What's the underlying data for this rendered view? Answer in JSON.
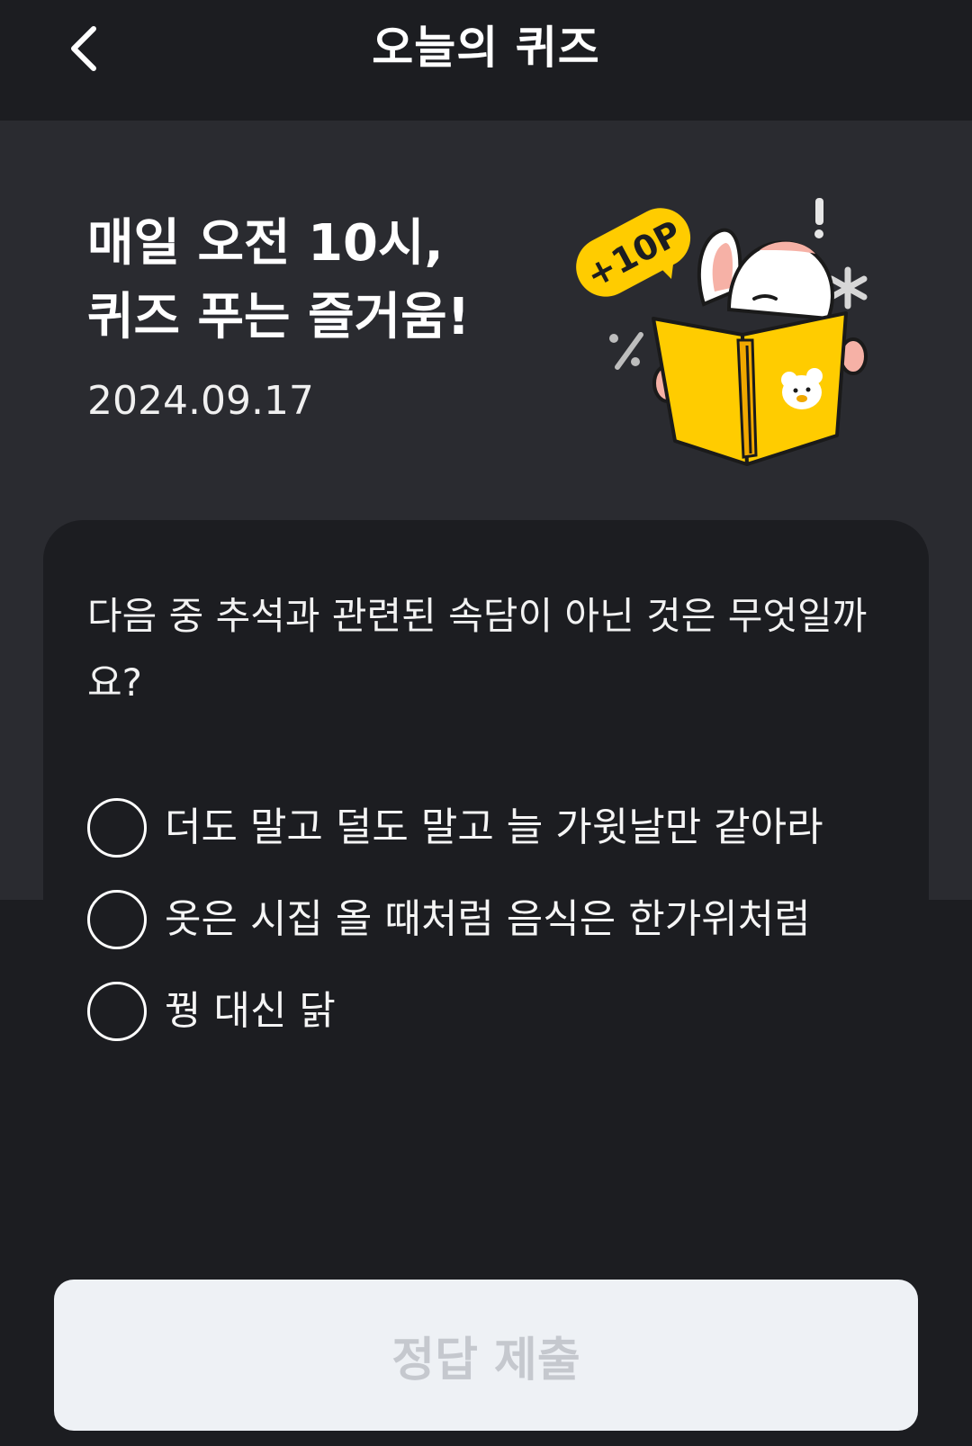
{
  "header": {
    "title": "오늘의 퀴즈",
    "back_icon": "chevron-left-icon"
  },
  "hero": {
    "title_line1": "매일 오전 10시,",
    "title_line2": "퀴즈 푸는 즐거움!",
    "date": "2024.09.17",
    "badge_text": "+10P",
    "illustration": "rabbit-reading-book"
  },
  "quiz": {
    "question": "다음 중 추석과 관련된 속담이 아닌 것은 무엇일까요?",
    "options": [
      {
        "label": "더도 말고 덜도 말고 늘 가윗날만 같아라",
        "selected": false
      },
      {
        "label": "옷은 시집 올 때처럼 음식은 한가위처럼",
        "selected": false
      },
      {
        "label": "꿩 대신 닭",
        "selected": false
      }
    ]
  },
  "submit": {
    "label": "정답 제출",
    "enabled": false
  },
  "colors": {
    "background": "#1c1d21",
    "hero_background": "#2a2b30",
    "accent": "#ffcc00",
    "button_disabled_bg": "#eef1f5",
    "button_disabled_text": "#c5c8ce"
  }
}
